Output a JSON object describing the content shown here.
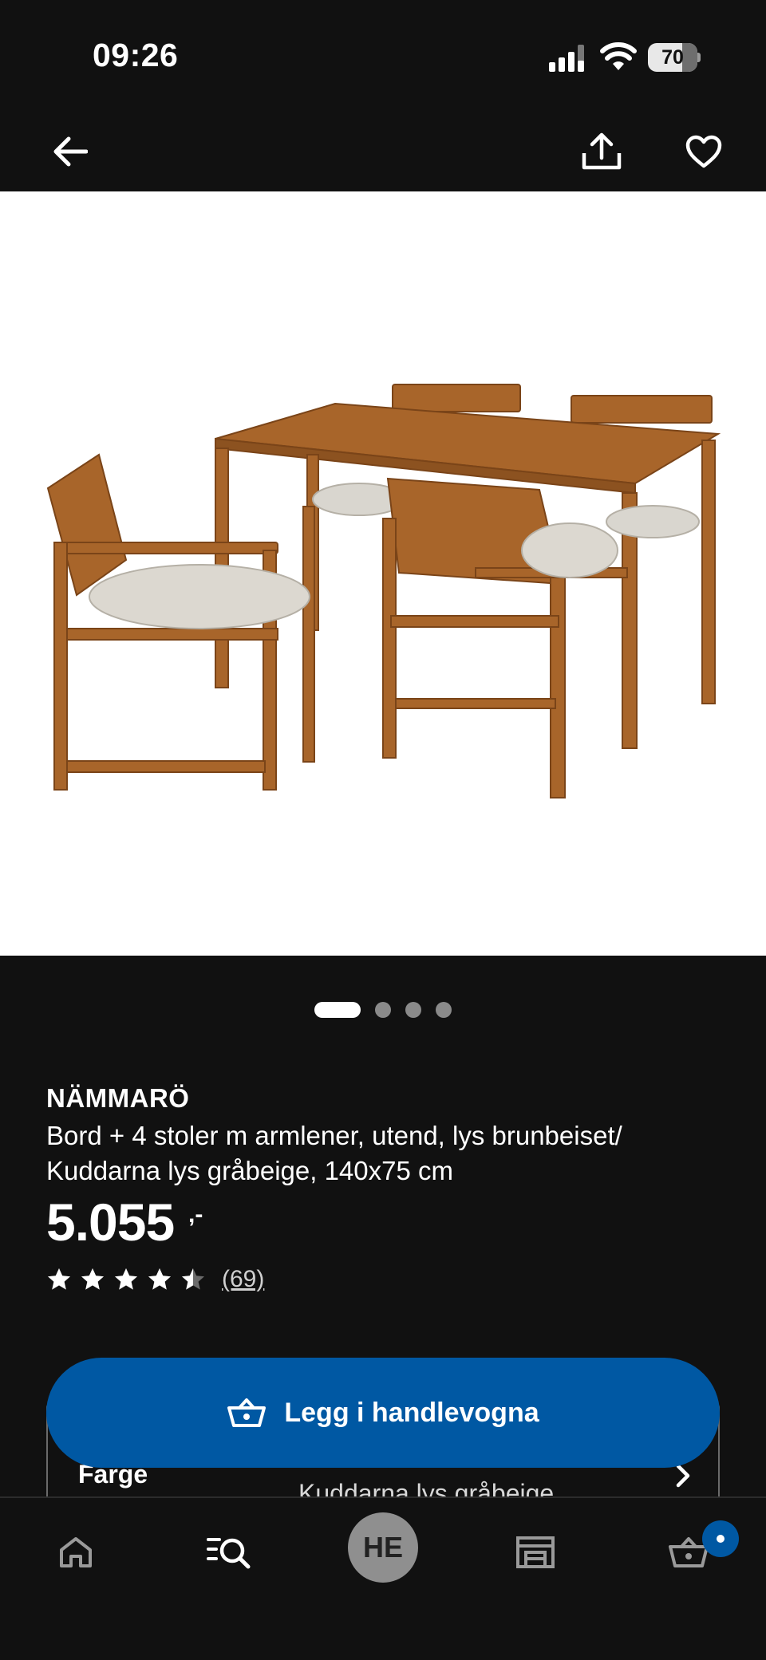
{
  "status_bar": {
    "time": "09:26",
    "battery_percent": "70"
  },
  "nav": {
    "back_icon": "arrow-left-icon",
    "share_icon": "share-icon",
    "favorite_icon": "heart-icon"
  },
  "carousel": {
    "image_count": 4,
    "active_index": 0
  },
  "product": {
    "name": "NÄMMARÖ",
    "description": "Bord + 4 stoler m armlener, utend, lys brunbeiset/ Kuddarna lys gråbeige, 140x75 cm",
    "price": "5.055",
    "price_suffix": ",-",
    "rating": 4.5,
    "rating_max": 5,
    "review_count": "(69)"
  },
  "variant": {
    "label": "Farge",
    "value": "Kuddarna lys gråbeige"
  },
  "cart_button": {
    "label": "Legg i handlevogna",
    "icon": "basket-icon"
  },
  "tab_bar": {
    "tabs": [
      {
        "name": "home",
        "icon": "home-icon"
      },
      {
        "name": "search",
        "icon": "search-list-icon"
      },
      {
        "name": "profile",
        "initials": "HE"
      },
      {
        "name": "store",
        "icon": "store-icon"
      },
      {
        "name": "cart",
        "icon": "basket-icon"
      }
    ],
    "cart_has_items": true
  },
  "colors": {
    "background": "#111111",
    "accent_blue": "#0058a3",
    "image_background": "#ffffff"
  }
}
